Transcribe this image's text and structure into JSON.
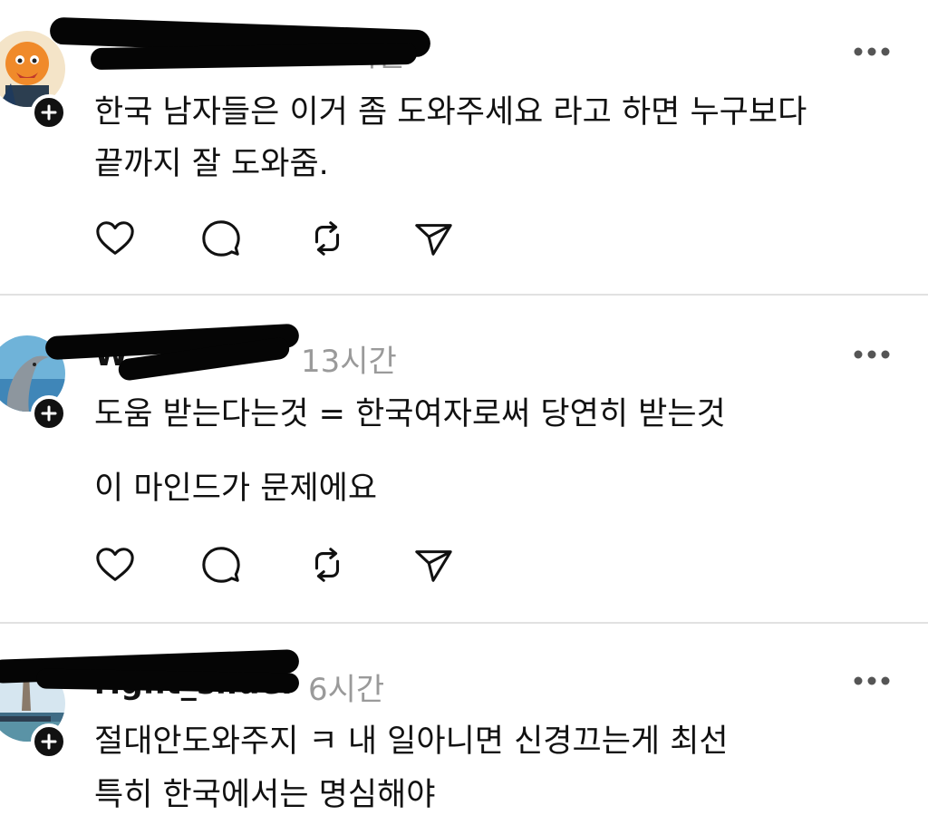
{
  "posts": [
    {
      "username": "",
      "timestamp": "시간",
      "lines": [
        "한국 남자들은 이거 좀 도와주세요 라고 하면 누구보다",
        "끝까지 잘 도와줌."
      ]
    },
    {
      "username": "W",
      "timestamp": "13시간",
      "lines": [
        "도움 받는다는것 =  한국여자로써 당연히 받는것",
        "이 마인드가 문제에요"
      ]
    },
    {
      "username": "right_slider",
      "timestamp": "6시간",
      "lines": [
        "절대안도와주지 ㅋ 내 일아니면 신경끄는게 최선",
        "특히 한국에서는 명심해야"
      ]
    }
  ],
  "icons": {
    "action_bar": [
      "heart-icon",
      "comment-icon",
      "repost-icon",
      "share-icon"
    ],
    "more": "more-horizontal-icon",
    "follow": "plus-icon"
  },
  "colors": {
    "text": "#111111",
    "timestamp": "#9a9a9a",
    "divider": "#e1e1e1",
    "redaction": "#050505"
  }
}
